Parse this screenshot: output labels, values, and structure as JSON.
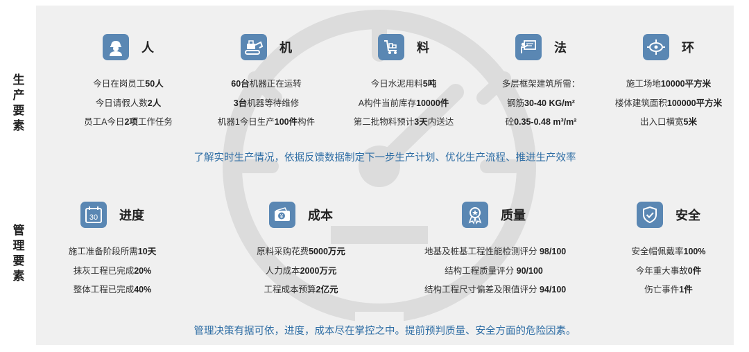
{
  "side": {
    "production": [
      "生",
      "产",
      "要",
      "素"
    ],
    "management": [
      "管",
      "理",
      "要",
      "素"
    ]
  },
  "production": {
    "items": [
      {
        "title": "人",
        "icon": "worker-icon",
        "lines": [
          [
            [
              "今日在岗员工",
              false
            ],
            [
              "50人",
              true
            ]
          ],
          [
            [
              "今日请假人数",
              false
            ],
            [
              "2人",
              true
            ]
          ],
          [
            [
              "员工A今日",
              false
            ],
            [
              "2项",
              true
            ],
            [
              "工作任务",
              false
            ]
          ]
        ]
      },
      {
        "title": "机",
        "icon": "machine-icon",
        "lines": [
          [
            [
              "60台",
              true
            ],
            [
              "机器正在运转",
              false
            ]
          ],
          [
            [
              "3台",
              true
            ],
            [
              "机器等待维修",
              false
            ]
          ],
          [
            [
              "机器1今日生产",
              false
            ],
            [
              "100件",
              true
            ],
            [
              "构件",
              false
            ]
          ]
        ]
      },
      {
        "title": "料",
        "icon": "material-cart-icon",
        "lines": [
          [
            [
              "今日水泥用料",
              false
            ],
            [
              "5吨",
              true
            ]
          ],
          [
            [
              "A构件当前库存",
              false
            ],
            [
              "10000件",
              true
            ]
          ],
          [
            [
              "第二批物料预计",
              false
            ],
            [
              "3天",
              true
            ],
            [
              "内送达",
              false
            ]
          ]
        ]
      },
      {
        "title": "法",
        "icon": "presentation-board-icon",
        "lines": [
          [
            [
              "多层框架建筑所需：",
              false
            ]
          ],
          [
            [
              "钢筋",
              false
            ],
            [
              "30-40 KG/m²",
              true
            ]
          ],
          [
            [
              "砼",
              false
            ],
            [
              "0.35-0.48 m³/m²",
              true
            ]
          ]
        ]
      },
      {
        "title": "环",
        "icon": "environment-target-icon",
        "lines": [
          [
            [
              "施工场地",
              false
            ],
            [
              "10000平方米",
              true
            ]
          ],
          [
            [
              "楼体建筑面积",
              false
            ],
            [
              "100000平方米",
              true
            ]
          ],
          [
            [
              "出入口横宽",
              false
            ],
            [
              "5米",
              true
            ]
          ]
        ]
      }
    ],
    "summary": "了解实时生产情况，依据反馈数据制定下一步生产计划、优化生产流程、推进生产效率"
  },
  "management": {
    "items": [
      {
        "title": "进度",
        "icon": "calendar-icon",
        "calendar_day": "30",
        "lines": [
          [
            [
              "施工准备阶段所需",
              false
            ],
            [
              "10天",
              true
            ]
          ],
          [
            [
              "抹灰工程已完成",
              false
            ],
            [
              "20%",
              true
            ]
          ],
          [
            [
              "整体工程已完成",
              false
            ],
            [
              "40%",
              true
            ]
          ]
        ]
      },
      {
        "title": "成本",
        "icon": "wallet-yen-icon",
        "lines": [
          [
            [
              "原料采购花费",
              false
            ],
            [
              "5000万元",
              true
            ]
          ],
          [
            [
              "人力成本",
              false
            ],
            [
              "2000万元",
              true
            ]
          ],
          [
            [
              "工程成本预算",
              false
            ],
            [
              "2亿元",
              true
            ]
          ]
        ]
      },
      {
        "title": "质量",
        "icon": "quality-medal-icon",
        "lines": [
          [
            [
              "地基及桩基工程性能检测评分 ",
              false
            ],
            [
              "98/100",
              true
            ]
          ],
          [
            [
              "结构工程质量评分 ",
              false
            ],
            [
              "90/100",
              true
            ]
          ],
          [
            [
              "结构工程尺寸偏差及限值评分 ",
              false
            ],
            [
              "94/100",
              true
            ]
          ]
        ]
      },
      {
        "title": "安全",
        "icon": "shield-check-icon",
        "lines": [
          [
            [
              "安全帽佩戴率",
              false
            ],
            [
              "100%",
              true
            ]
          ],
          [
            [
              "今年重大事故",
              false
            ],
            [
              "0件",
              true
            ]
          ],
          [
            [
              "伤亡事件",
              false
            ],
            [
              "1件",
              true
            ]
          ]
        ]
      }
    ],
    "summary": "管理决策有据可依，进度，成本尽在掌控之中。提前预判质量、安全方面的危险因素。"
  },
  "colors": {
    "icon_bg": "#5a87b3",
    "summary_text": "#2f6ea5",
    "panel_bg": "#f0f0f0",
    "watermark": "#dcdcdc"
  }
}
